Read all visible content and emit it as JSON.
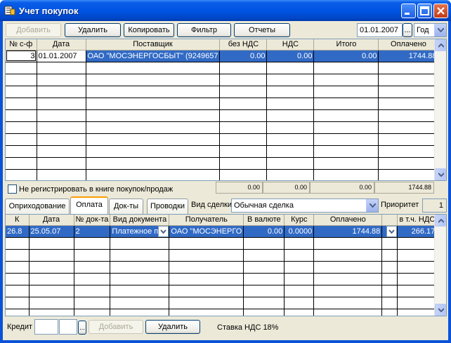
{
  "window": {
    "title": "Учет покупок"
  },
  "toolbar": {
    "add_label": "Добавить",
    "delete_label": "Удалить",
    "copy_label": "Копировать",
    "filter_label": "Фильтр",
    "reports_label": "Отчеты",
    "date_value": "01.01.2007",
    "date_btn_label": "...",
    "period_value": "Год"
  },
  "invoices": {
    "columns": [
      "№ с-ф",
      "Дата",
      "Поставщик",
      "без НДС",
      "НДС",
      "Итого",
      "Оплачено"
    ],
    "rows": [
      [
        "3",
        "01.01.2007",
        "ОАО \"МОСЭНЕРГОСБЫТ\" (9249657",
        "0.00",
        "0.00",
        "0.00",
        "1744.88"
      ]
    ],
    "totals": [
      "0.00",
      "0.00",
      "0.00",
      "1744.88"
    ]
  },
  "no_register_label": "Не регистрировать в книге покупок/продаж",
  "tabs": [
    "Оприходование",
    "Оплата",
    "Док-ты",
    "Проводки"
  ],
  "deal": {
    "label": "Вид сделки",
    "value": "Обычная сделка",
    "priority_label": "Приоритет",
    "priority_value": "1"
  },
  "payments": {
    "columns": [
      "К",
      "Дата",
      "№ док-та",
      "Вид документа",
      "Получатель",
      "В валюте",
      "Курс",
      "Оплачено",
      "",
      "в т.ч. НДС"
    ],
    "rows": [
      [
        "26.8",
        "25.05.07",
        "2",
        "Платежное п",
        "ОАО \"МОСЭНЕРГО",
        "0.00",
        "0.0000",
        "1744.88",
        "",
        "266.17"
      ]
    ]
  },
  "bottom": {
    "credit_label": "Кредит",
    "dots_label": "...",
    "add_label": "Добавить",
    "delete_label": "Удалить",
    "vat_rate_text": "Ставка НДС 18%"
  },
  "colors": {
    "title_blue": "#0054e3",
    "selection": "#316ac5",
    "face": "#ece9d8"
  }
}
